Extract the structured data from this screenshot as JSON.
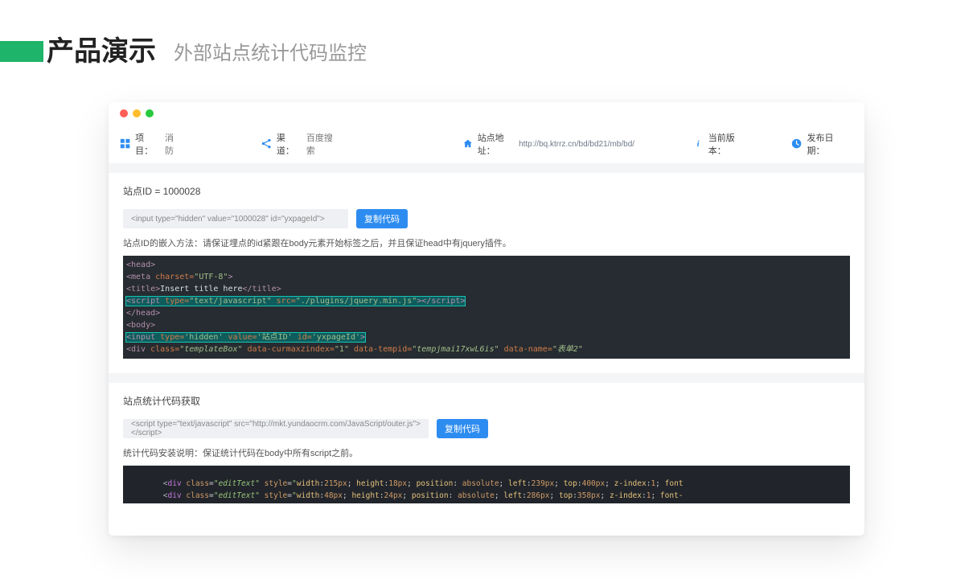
{
  "slide": {
    "title": "产品演示",
    "subtitle": "外部站点统计代码监控"
  },
  "header": {
    "items": [
      {
        "label": "项目：",
        "value": "消防"
      },
      {
        "label": "渠道：",
        "value": "百度搜索"
      },
      {
        "label": "站点地址：",
        "value": "http://bq.ktrrz.cn/bd/bd21/mb/bd/"
      },
      {
        "label": "当前版本：",
        "value": ""
      },
      {
        "label": "发布日期：",
        "value": ""
      }
    ]
  },
  "panel1": {
    "title": "站点ID = 1000028",
    "input_code": "<input type=\"hidden\" value=\"1000028\" id=\"yxpageId\">",
    "copy_label": "复制代码",
    "desc": "站点ID的嵌入方法：请保证埋点的id紧跟在body元素开始标签之后，并且保证head中有jquery插件。",
    "code_lines": {
      "l1_a": "<head>",
      "l2_a": "<meta ",
      "l2_b": "charset=",
      "l2_c": "\"UTF-8\"",
      "l2_d": ">",
      "l3_a": "<title>",
      "l3_b": "Insert title here",
      "l3_c": "</title>",
      "l4_a": "<script ",
      "l4_b": "type=",
      "l4_c": "\"text/javascript\"",
      "l4_d": " src=",
      "l4_e": "\"./plugins/jquery.min.js\"",
      "l4_f": "></script>",
      "l5_a": "</head>",
      "l6_a": "<body>",
      "l7_a": "<input ",
      "l7_b": "type=",
      "l7_c": "'hidden'",
      "l7_d": " value=",
      "l7_e": "'站点ID'",
      "l7_f": " id=",
      "l7_g": "'yxpageId'",
      "l7_h": ">",
      "l8_a": "<div ",
      "l8_b": "class=",
      "l8_c": "\"templateBox\"",
      "l8_d": " data-curmaxzindex=",
      "l8_e": "\"1\"",
      "l8_f": " data-tempid=",
      "l8_g": "\"tempjmai17xwL6is\"",
      "l8_h": " data-name=",
      "l8_i": "\"表单2\""
    }
  },
  "panel2": {
    "title": "站点统计代码获取",
    "input_code": "<script type=\"text/javascript\" src=\"http://mkt.yundaocrm.com/JavaScript/outer.js\"></script>",
    "copy_label": "复制代码",
    "desc": "统计代码安装说明：保证统计代码在body中所有script之前。",
    "code_lines": {
      "l1": "        <div class=\"editText\" style=\"width:215px; height:18px; position: absolute; left:239px; top:400px; z-index:1; font",
      "l2": "        <div class=\"editText\" style=\"width:48px; height:24px; position: absolute; left:286px; top:358px; z-index:1; font-"
    }
  }
}
